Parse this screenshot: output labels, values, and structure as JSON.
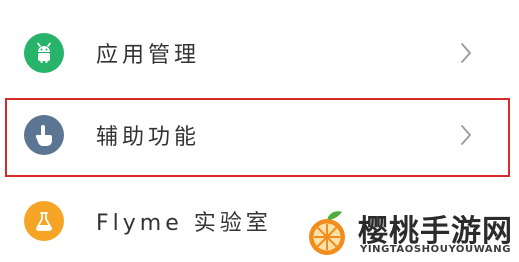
{
  "settings_list": {
    "items": [
      {
        "label": "应用管理",
        "icon": "android-icon",
        "icon_color": "#27b36a",
        "chevron": "chevron-right-icon"
      },
      {
        "label": "辅助功能",
        "icon": "hand-pointer-icon",
        "icon_color": "#5c7592",
        "chevron": "chevron-right-icon"
      },
      {
        "label": "Flyme 实验室",
        "icon": "flask-icon",
        "icon_color": "#f5a425"
      }
    ]
  },
  "highlight_color": "#d62b2b",
  "watermark": {
    "title": "樱桃手游网",
    "subtitle": "YINGTAOSHOUYOUWANG",
    "logo": "orange-fruit-logo"
  }
}
